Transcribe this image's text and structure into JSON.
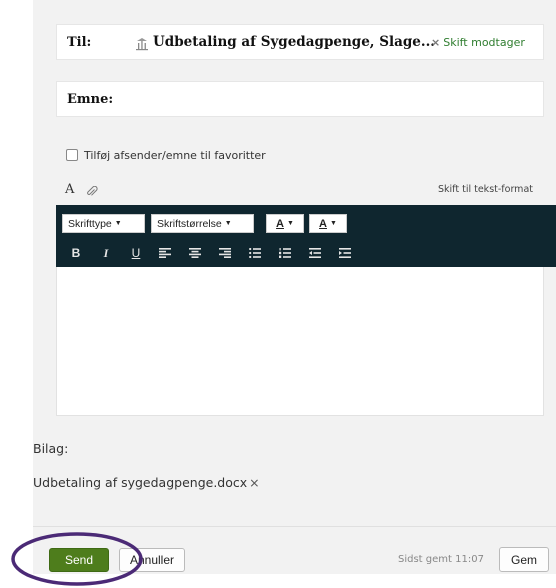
{
  "compose": {
    "to_label": "Til:",
    "recipient_name": "Udbetaling af Sygedagpenge, Slage...",
    "change_recipient": "Skift modtager",
    "subject_label": "Emne:",
    "subject_value": "",
    "favorites_label": "Tilføj afsender/emne til favoritter",
    "favorites_checked": false
  },
  "format_bar": {
    "text_icon_glyph": "A",
    "attach_icon": "paperclip-icon",
    "switch_text_format": "Skift til tekst-format"
  },
  "toolbar": {
    "font_label": "Skrifttype",
    "size_label": "Skriftstørrelse",
    "text_color_label": "A",
    "bg_color_label": "A",
    "bold": "B",
    "italic": "I",
    "underline": "U",
    "buttons": [
      "bold",
      "italic",
      "underline",
      "align-left",
      "align-center",
      "align-right",
      "bullet-list",
      "numbered-list",
      "outdent",
      "indent"
    ]
  },
  "attachments": {
    "label": "Bilag:",
    "items": [
      {
        "name": "Udbetaling af sygedagpenge.docx",
        "remove": "×"
      }
    ]
  },
  "footer": {
    "send": "Send",
    "cancel": "Annuller",
    "saved_at": "Sidst gemt 11:07",
    "save": "Gem"
  },
  "colors": {
    "toolbar_bg": "#0f262f",
    "send_bg": "#4e7d1c",
    "accent_link": "#2f7d2f",
    "highlight_ring": "#4b2a76"
  }
}
